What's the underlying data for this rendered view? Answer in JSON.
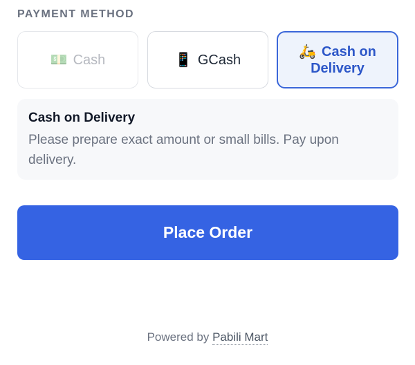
{
  "payment": {
    "label": "PAYMENT METHOD",
    "methods": [
      {
        "icon": "💵",
        "icon_name": "cash-icon",
        "label": "Cash",
        "state": "disabled"
      },
      {
        "icon": "📱",
        "icon_name": "mobile-phone-icon",
        "label": "GCash",
        "state": "default"
      },
      {
        "icon": "🛵",
        "icon_name": "scooter-icon",
        "label_line1": "Cash on",
        "label_line2": "Delivery",
        "state": "selected"
      }
    ]
  },
  "info": {
    "title": "Cash on Delivery",
    "text": "Please prepare exact amount or small bills. Pay upon delivery."
  },
  "actions": {
    "place_order_label": "Place Order"
  },
  "footer": {
    "prefix": "Powered by",
    "brand": "Pabili Mart"
  },
  "colors": {
    "accent": "#3563e3",
    "selected_bg": "#eef3fc",
    "selected_border": "#3a66d9"
  }
}
